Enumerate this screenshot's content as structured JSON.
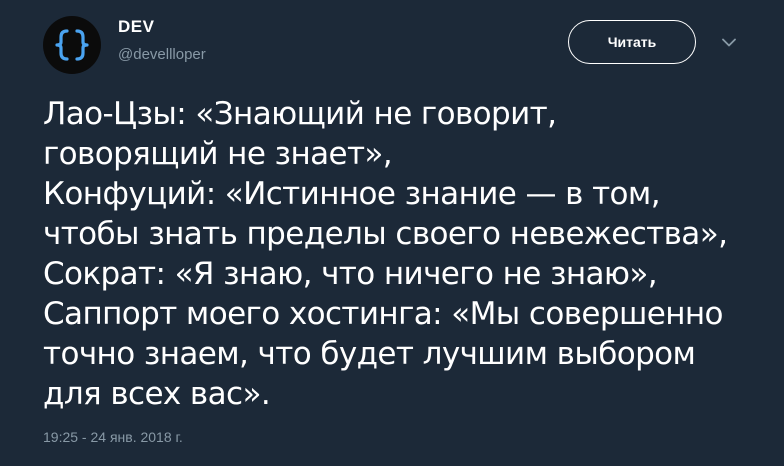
{
  "author": {
    "display_name": "DEV",
    "handle": "@devellloper",
    "avatar_glyph": "{}"
  },
  "follow_button": {
    "label": "Читать"
  },
  "icons": {
    "menu": "chevron-down-icon",
    "avatar": "curly-braces-logo"
  },
  "tweet": {
    "lines": [
      "Лао-Цзы: «Знающий не говорит,",
      "говорящий не знает»,",
      "Конфуций: «Истинное знание — в том,",
      "чтобы знать пределы своего невежества»,",
      "Сократ: «Я знаю, что ничего не знаю»,",
      "Саппорт моего хостинга: «Мы совершенно",
      "точно знаем, что будет лучшим выбором",
      "для всех вас»."
    ],
    "timestamp": "19:25 - 24 янв. 2018 г."
  },
  "colors": {
    "background": "#1c2938",
    "text": "#ffffff",
    "secondary_text": "#8899a6",
    "avatar_bg": "#0b0b0b",
    "avatar_braces": "#4aa3f0"
  }
}
